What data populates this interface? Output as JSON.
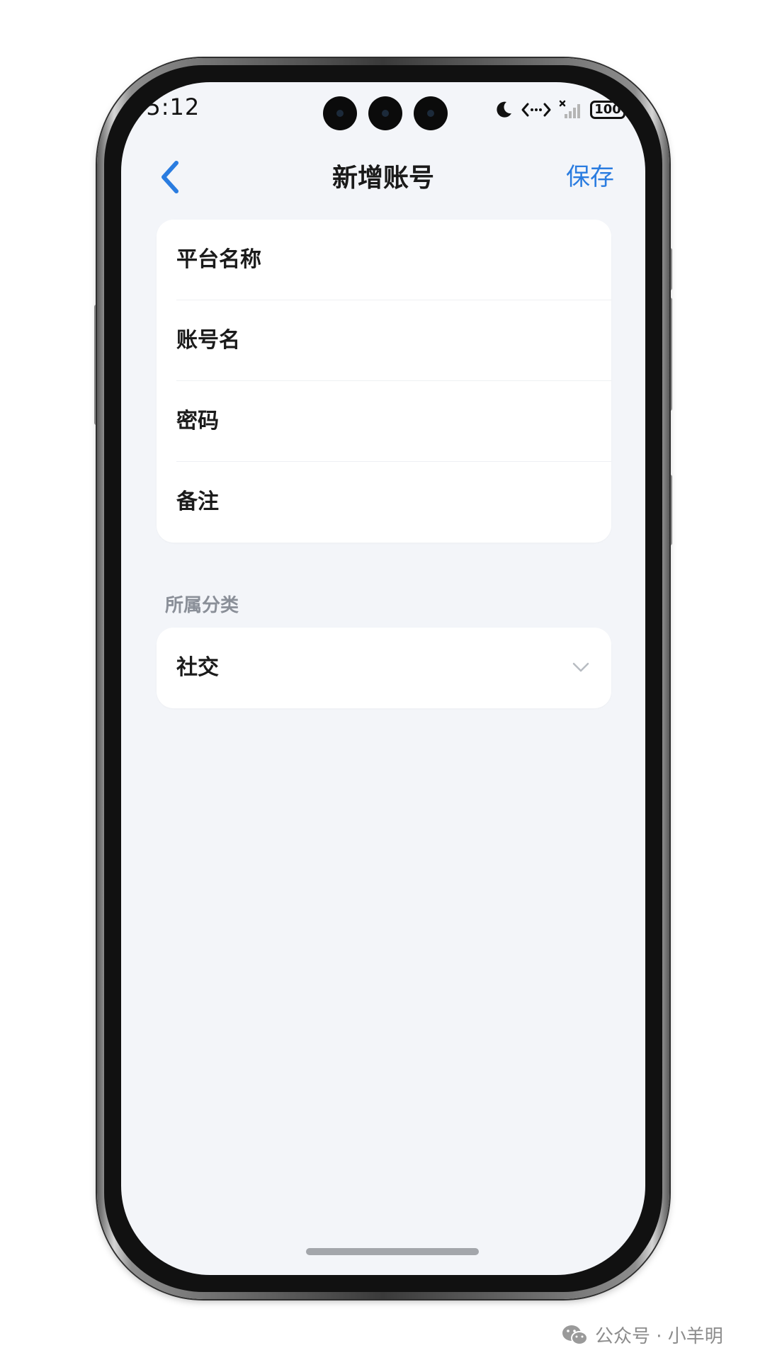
{
  "status_bar": {
    "time": "05:12",
    "battery": "100",
    "icons": [
      "moon-icon",
      "data-transfer-icon",
      "no-signal-icon",
      "battery-icon"
    ]
  },
  "nav": {
    "title": "新增账号",
    "save_label": "保存",
    "back_icon": "chevron-left-icon",
    "accent_color": "#2a7ce0"
  },
  "form": {
    "fields": [
      {
        "label": "平台名称",
        "value": ""
      },
      {
        "label": "账号名",
        "value": ""
      },
      {
        "label": "密码",
        "value": ""
      },
      {
        "label": "备注",
        "value": ""
      }
    ]
  },
  "category": {
    "section_label": "所属分类",
    "selected": "社交",
    "icon": "chevron-down-icon"
  },
  "watermark": {
    "text": "公众号 · 小羊明",
    "icon": "wechat-icon"
  },
  "colors": {
    "screen_background": "#f3f5f9",
    "card_background": "#ffffff",
    "section_label": "#8a8f98"
  }
}
